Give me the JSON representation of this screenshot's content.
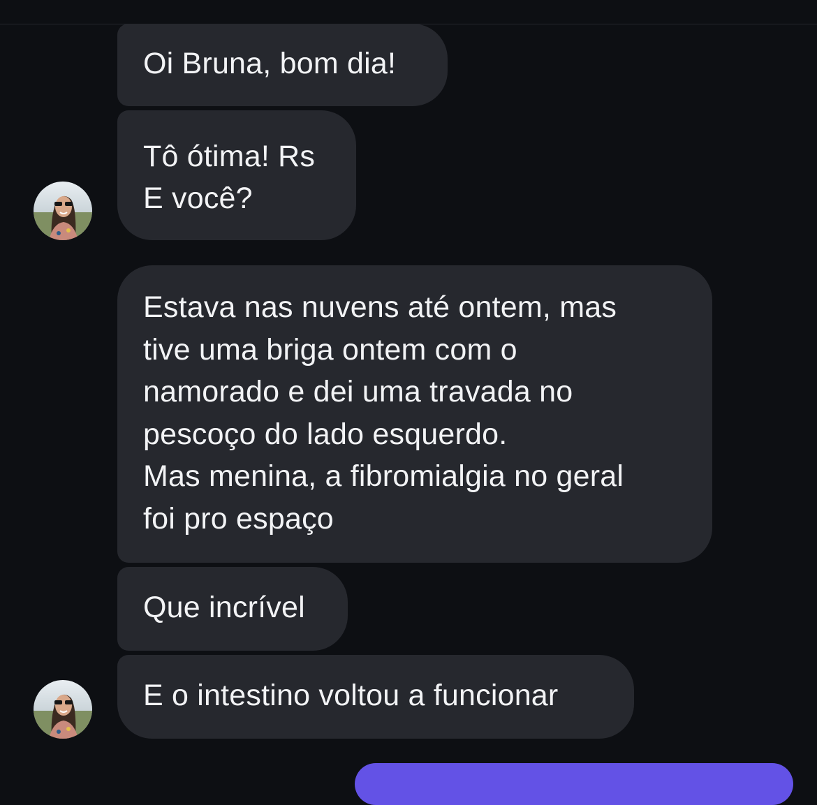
{
  "conversation": {
    "messages": [
      {
        "lines": [
          "Oi Bruna, bom dia!"
        ]
      },
      {
        "lines": [
          "Tô ótima! Rs",
          "E você?"
        ]
      },
      {
        "lines": [
          "Estava nas nuvens até ontem, mas",
          "tive uma briga ontem com o",
          "namorado e dei uma travada no",
          "pescoço do lado esquerdo.",
          "Mas menina, a fibromialgia no geral",
          "foi pro espaço"
        ]
      },
      {
        "lines": [
          "Que incrível"
        ]
      },
      {
        "lines": [
          "E o intestino voltou a funcionar"
        ]
      }
    ]
  },
  "colors": {
    "background": "#0d0f13",
    "incoming_bubble": "#26282e",
    "outgoing_bubble": "#6352e6",
    "text": "#f2f3f5"
  }
}
